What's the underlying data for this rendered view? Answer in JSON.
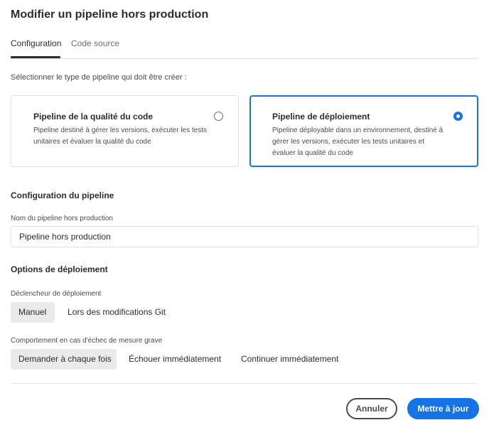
{
  "dialog": {
    "title": "Modifier un pipeline hors production"
  },
  "tabs": [
    {
      "label": "Configuration",
      "active": true
    },
    {
      "label": "Code source",
      "active": false
    }
  ],
  "pipeline_type": {
    "prompt": "Sélectionner le type de pipeline qui doit être créer :",
    "options": [
      {
        "title": "Pipeline de la qualité du code",
        "description": "Pipeline destiné à gérer les versions, exécuter les tests unitaires et évaluer la qualité du code",
        "selected": false
      },
      {
        "title": "Pipeline de déploiement",
        "description": "Pipeline déployable dans un environnement, destiné à gérer les versions, exécuter les tests unitaires et évaluer la qualité du code",
        "selected": true
      }
    ]
  },
  "pipeline_config": {
    "heading": "Configuration du pipeline",
    "name_label": "Nom du pipeline hors production",
    "name_value": "Pipeline hors production"
  },
  "deployment_options": {
    "heading": "Options de déploiement",
    "trigger_label": "Déclencheur de déploiement",
    "trigger_options": [
      {
        "label": "Manuel",
        "selected": true
      },
      {
        "label": "Lors des modifications Git",
        "selected": false
      }
    ],
    "failure_label": "Comportement en cas d'échec de mesure grave",
    "failure_options": [
      {
        "label": "Demander à chaque fois",
        "selected": true
      },
      {
        "label": "Échouer immédiatement",
        "selected": false
      },
      {
        "label": "Continuer immédiatement",
        "selected": false
      }
    ]
  },
  "footer": {
    "cancel_label": "Annuler",
    "submit_label": "Mettre à jour"
  },
  "colors": {
    "accent": "#1473e6",
    "selected_segment": "#eaeaea",
    "border": "#e1e1e1"
  }
}
